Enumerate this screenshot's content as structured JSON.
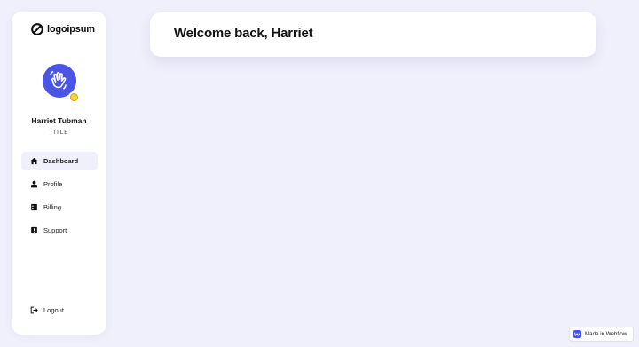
{
  "brand": {
    "logo_text": "logoipsum",
    "logo_icon": "logo-slash-circle"
  },
  "user": {
    "name": "Harriet Tubman",
    "title": "TITLE",
    "avatar_icon": "waving-hand-avatar",
    "badge_icon": "smiley-emoji"
  },
  "nav": {
    "items": [
      {
        "label": "Dashboard",
        "icon": "home-icon",
        "active": true
      },
      {
        "label": "Profile",
        "icon": "person-icon",
        "active": false
      },
      {
        "label": "Billing",
        "icon": "billing-icon",
        "active": false
      },
      {
        "label": "Support",
        "icon": "support-icon",
        "active": false
      }
    ],
    "logout_label": "Logout",
    "logout_icon": "logout-icon"
  },
  "main": {
    "welcome": "Welcome back, Harriet"
  },
  "footer_badge": {
    "label": "Made in Webflow",
    "icon": "webflow-icon"
  },
  "colors": {
    "background": "#f0f0fc",
    "accent": "#4a55e6",
    "card": "#ffffff",
    "active_nav": "#f0f0fc",
    "webflow": "#4353ff"
  }
}
